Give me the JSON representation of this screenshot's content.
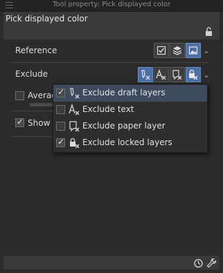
{
  "window": {
    "title": "Tool property: Pick displayed color",
    "menu_icon": "hamburger-menu-icon"
  },
  "header": {
    "tool_name": "Pick displayed color",
    "lock_icon": "unlock-icon"
  },
  "reference": {
    "label": "Reference",
    "buttons": [
      {
        "icon": "checkbox-all-layers-icon",
        "active": false
      },
      {
        "icon": "layers-stack-icon",
        "active": false
      },
      {
        "icon": "image-layer-icon",
        "active": true
      }
    ]
  },
  "exclude": {
    "label": "Exclude",
    "buttons": [
      {
        "icon": "exclude-draft-icon",
        "active": true
      },
      {
        "icon": "exclude-text-icon",
        "active": false
      },
      {
        "icon": "exclude-paper-icon",
        "active": false
      },
      {
        "icon": "exclude-locked-icon",
        "active": true
      }
    ]
  },
  "average": {
    "label": "Averag",
    "checked": false
  },
  "show": {
    "label": "Show c",
    "checked": true
  },
  "dropdown": {
    "items": [
      {
        "label": "Exclude draft layers",
        "checked": true,
        "hover": true,
        "icon": "draft-layer-icon"
      },
      {
        "label": "Exclude text",
        "checked": false,
        "hover": false,
        "icon": "text-layer-icon"
      },
      {
        "label": "Exclude paper layer",
        "checked": false,
        "hover": false,
        "icon": "paper-layer-icon"
      },
      {
        "label": "Exclude locked layers",
        "checked": true,
        "hover": false,
        "icon": "locked-layer-icon"
      }
    ]
  },
  "footer": {
    "icons": [
      "timer-icon",
      "wrench-icon"
    ]
  },
  "colors": {
    "accent": "#4d6fa8",
    "hover": "#3e4a5e",
    "background": "#2b2b2b"
  }
}
